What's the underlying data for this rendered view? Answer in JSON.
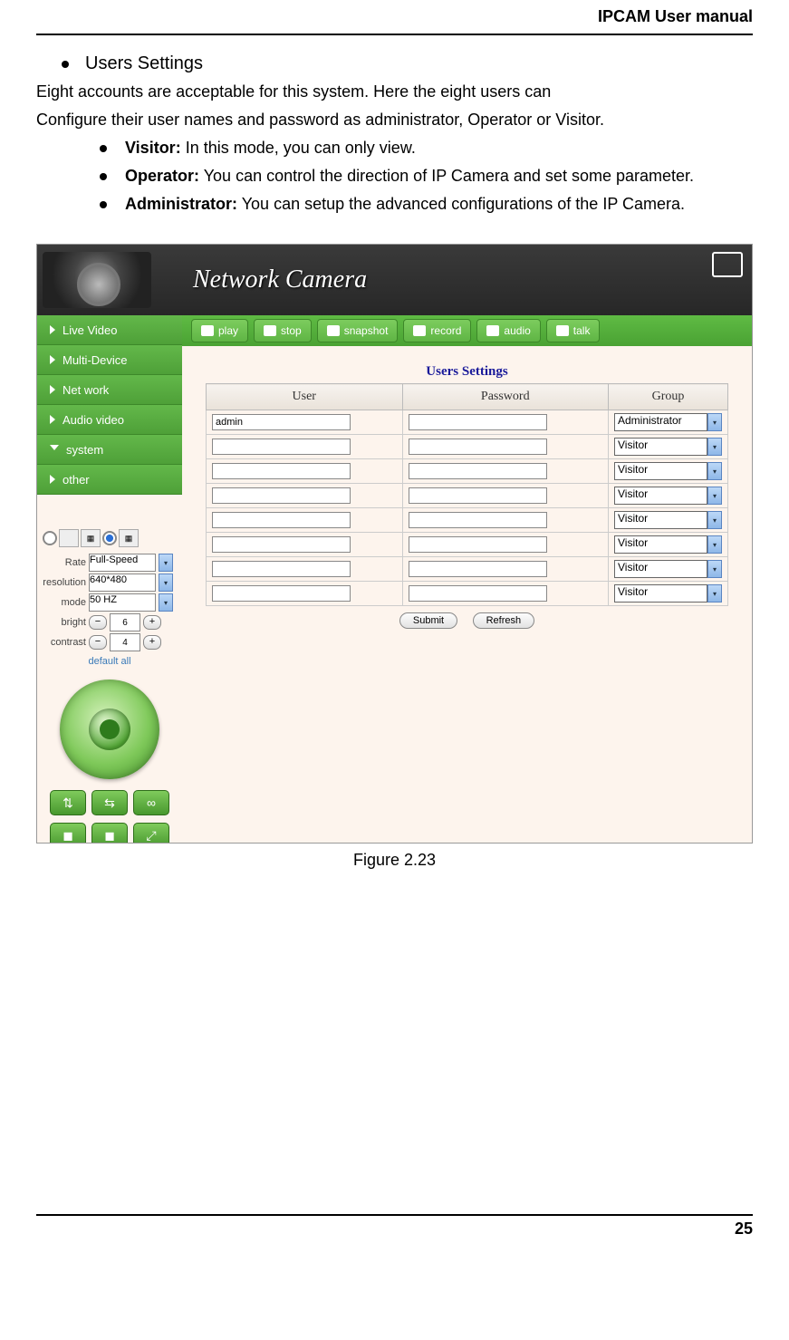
{
  "doc": {
    "header": "IPCAM User manual",
    "page_number": "25",
    "figure_caption": "Figure 2.23",
    "section_title": "Users Settings",
    "intro_line1": "Eight accounts are acceptable for this system. Here the eight users can",
    "intro_line2": "Configure their user names and password as administrator, Operator or Visitor.",
    "bullets": [
      {
        "bold": "Visitor:",
        "text": " In this mode, you can only view."
      },
      {
        "bold": "Operator:",
        "text": " You can control the direction of IP Camera and set some parameter."
      },
      {
        "bold": "Administrator:",
        "text": " You can setup the advanced configurations of the IP Camera."
      }
    ]
  },
  "ui": {
    "brand": "Network Camera",
    "watermark": "Network Ca",
    "toolbar": [
      {
        "icon": "play-icon",
        "label": "play"
      },
      {
        "icon": "stop-icon",
        "label": "stop"
      },
      {
        "icon": "snapshot-icon",
        "label": "snapshot"
      },
      {
        "icon": "record-icon",
        "label": "record"
      },
      {
        "icon": "audio-icon",
        "label": "audio"
      },
      {
        "icon": "talk-icon",
        "label": "talk"
      }
    ],
    "nav": [
      "Live Video",
      "Multi-Device",
      "Net work",
      "Audio video",
      "system",
      "other"
    ],
    "nav_expanded_index": 4,
    "controls": {
      "rate_label": "Rate",
      "rate_value": "Full-Speed",
      "resolution_label": "resolution",
      "resolution_value": "640*480",
      "mode_label": "mode",
      "mode_value": "50 HZ",
      "bright_label": "bright",
      "bright_value": "6",
      "contrast_label": "contrast",
      "contrast_value": "4",
      "default_all": "default all"
    },
    "form": {
      "title": "Users Settings",
      "col_user": "User",
      "col_password": "Password",
      "col_group": "Group",
      "rows": [
        {
          "user": "admin",
          "group": "Administrator"
        },
        {
          "user": "",
          "group": "Visitor"
        },
        {
          "user": "",
          "group": "Visitor"
        },
        {
          "user": "",
          "group": "Visitor"
        },
        {
          "user": "",
          "group": "Visitor"
        },
        {
          "user": "",
          "group": "Visitor"
        },
        {
          "user": "",
          "group": "Visitor"
        },
        {
          "user": "",
          "group": "Visitor"
        }
      ],
      "submit": "Submit",
      "refresh": "Refresh"
    }
  }
}
